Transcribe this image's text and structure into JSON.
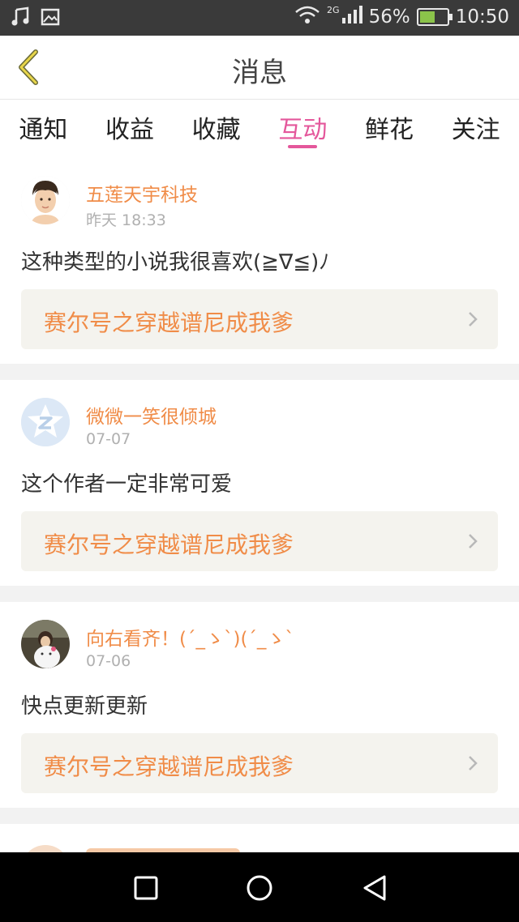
{
  "status_bar": {
    "network": "2G",
    "battery_text": "56%",
    "battery_level": 0.56,
    "time": "10:50",
    "icons": [
      "music-icon",
      "image-icon",
      "wifi-icon",
      "signal-icon",
      "battery-icon"
    ]
  },
  "header": {
    "title": "消息",
    "back_icon": "chevron-left-icon"
  },
  "tabs": [
    {
      "label": "通知",
      "active": false
    },
    {
      "label": "收益",
      "active": false
    },
    {
      "label": "收藏",
      "active": false
    },
    {
      "label": "互动",
      "active": true
    },
    {
      "label": "鲜花",
      "active": false
    },
    {
      "label": "关注",
      "active": false
    }
  ],
  "colors": {
    "accent": "#e4579b",
    "username": "#f08c48",
    "book_bg": "#f4f3ee",
    "divider": "#f2f2f2"
  },
  "messages": [
    {
      "username": "五莲天宇科技",
      "time": "昨天 18:33",
      "text": "这种类型的小说我很喜欢(≧∇≦)ﾉ",
      "book": "赛尔号之穿越谱尼成我爹",
      "avatar": "boy-avatar"
    },
    {
      "username": "微微一笑很倾城",
      "time": "07-07",
      "text": "这个作者一定非常可爱",
      "book": "赛尔号之穿越谱尼成我爹",
      "avatar": "default-z-avatar"
    },
    {
      "username": "向右看齐！(´_ゝ`)(´_ゝ`",
      "time": "07-06",
      "text": "快点更新更新",
      "book": "赛尔号之穿越谱尼成我爹",
      "avatar": "girl-photo-avatar"
    }
  ],
  "nav_bar": {
    "icons": [
      "recent-apps-icon",
      "home-icon",
      "back-icon"
    ]
  }
}
